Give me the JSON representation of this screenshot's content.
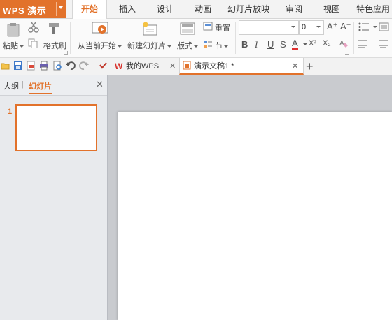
{
  "app": {
    "title": "WPS 演示"
  },
  "menu": {
    "tabs": [
      {
        "label": "开始"
      },
      {
        "label": "插入"
      },
      {
        "label": "设计"
      },
      {
        "label": "动画"
      },
      {
        "label": "幻灯片放映"
      },
      {
        "label": "审阅"
      },
      {
        "label": "视图"
      },
      {
        "label": "特色应用"
      }
    ]
  },
  "ribbon": {
    "paste": "粘贴",
    "format_painter": "格式刷",
    "from_current": "从当前开始",
    "new_slide": "新建幻灯片",
    "layout": "版式",
    "reset": "重置",
    "section": "节",
    "font_size": "0",
    "font_grow": "A⁺",
    "font_shrink": "A⁻",
    "bold": "B",
    "italic": "I",
    "underline": "U",
    "strike": "S",
    "font_color": "A",
    "superscript": "X²",
    "subscript": "X₂"
  },
  "doc_tabs": {
    "home": "我的WPS",
    "current": "演示文稿1 *"
  },
  "left_pane": {
    "outline": "大纲",
    "slides": "幻灯片",
    "slide_number": "1"
  },
  "colors": {
    "accent": "#e2722b",
    "canvas": "#c9cbcf"
  }
}
